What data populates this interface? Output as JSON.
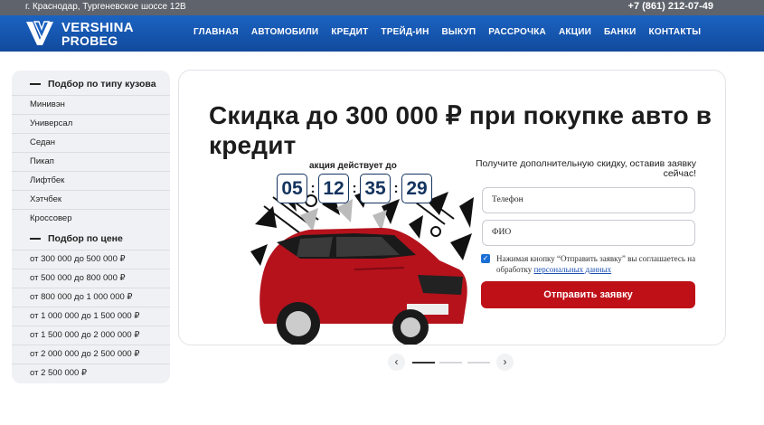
{
  "topbar": {
    "address": "г. Краснодар, Тургеневское шоссе 12В",
    "phone": "+7 (861) 212-07-49"
  },
  "logo": {
    "line1": "VERSHINA",
    "line2": "PROBEG"
  },
  "nav": {
    "items": [
      {
        "label": "ГЛАВНАЯ"
      },
      {
        "label": "АВТОМОБИЛИ"
      },
      {
        "label": "КРЕДИТ"
      },
      {
        "label": "ТРЕЙД-ИН"
      },
      {
        "label": "ВЫКУП"
      },
      {
        "label": "РАССРОЧКА"
      },
      {
        "label": "АКЦИИ"
      },
      {
        "label": "БАНКИ"
      },
      {
        "label": "КОНТАКТЫ"
      }
    ]
  },
  "sidebar": {
    "body_title": "Подбор по типу кузова",
    "body_types": [
      {
        "label": "Минивэн"
      },
      {
        "label": "Универсал"
      },
      {
        "label": "Седан"
      },
      {
        "label": "Пикап"
      },
      {
        "label": "Лифтбек"
      },
      {
        "label": "Хэтчбек"
      },
      {
        "label": "Кроссовер"
      }
    ],
    "price_title": "Подбор по цене",
    "price_ranges": [
      {
        "label": "от 300 000 до 500 000 ₽"
      },
      {
        "label": "от 500 000 до 800 000 ₽"
      },
      {
        "label": "от 800 000 до 1 000 000 ₽"
      },
      {
        "label": "от 1 000 000 до 1 500 000 ₽"
      },
      {
        "label": "от 1 500 000 до 2 000 000 ₽"
      },
      {
        "label": "от 2 000 000 до 2 500 000 ₽"
      },
      {
        "label": "от 2 500 000 ₽"
      }
    ]
  },
  "banner": {
    "headline": "Скидка до 300 000 ₽ при покупке авто в кредит",
    "promo_label": "акция действует до",
    "timer": {
      "d": "05",
      "h": "12",
      "m": "35",
      "s": "29"
    },
    "offer_text": "Получите дополнительную скидку, оставив заявку сейчас!",
    "phone_placeholder": "Телефон",
    "name_placeholder": "ФИО",
    "consent_text": "Нажимая кнопку “Отправить заявку” вы соглашаетесь на обработку ",
    "consent_link": "персональных данных",
    "submit_label": "Отправить заявку"
  },
  "slider": {
    "prev_icon": "chevron-left-icon",
    "next_icon": "chevron-right-icon",
    "slides": 3,
    "active_index": 0
  },
  "colors": {
    "topbar": "#5f636b",
    "nav": "#1b63c2",
    "submit": "#bf1018",
    "timer": "#14345f",
    "car": "#b5121c"
  }
}
